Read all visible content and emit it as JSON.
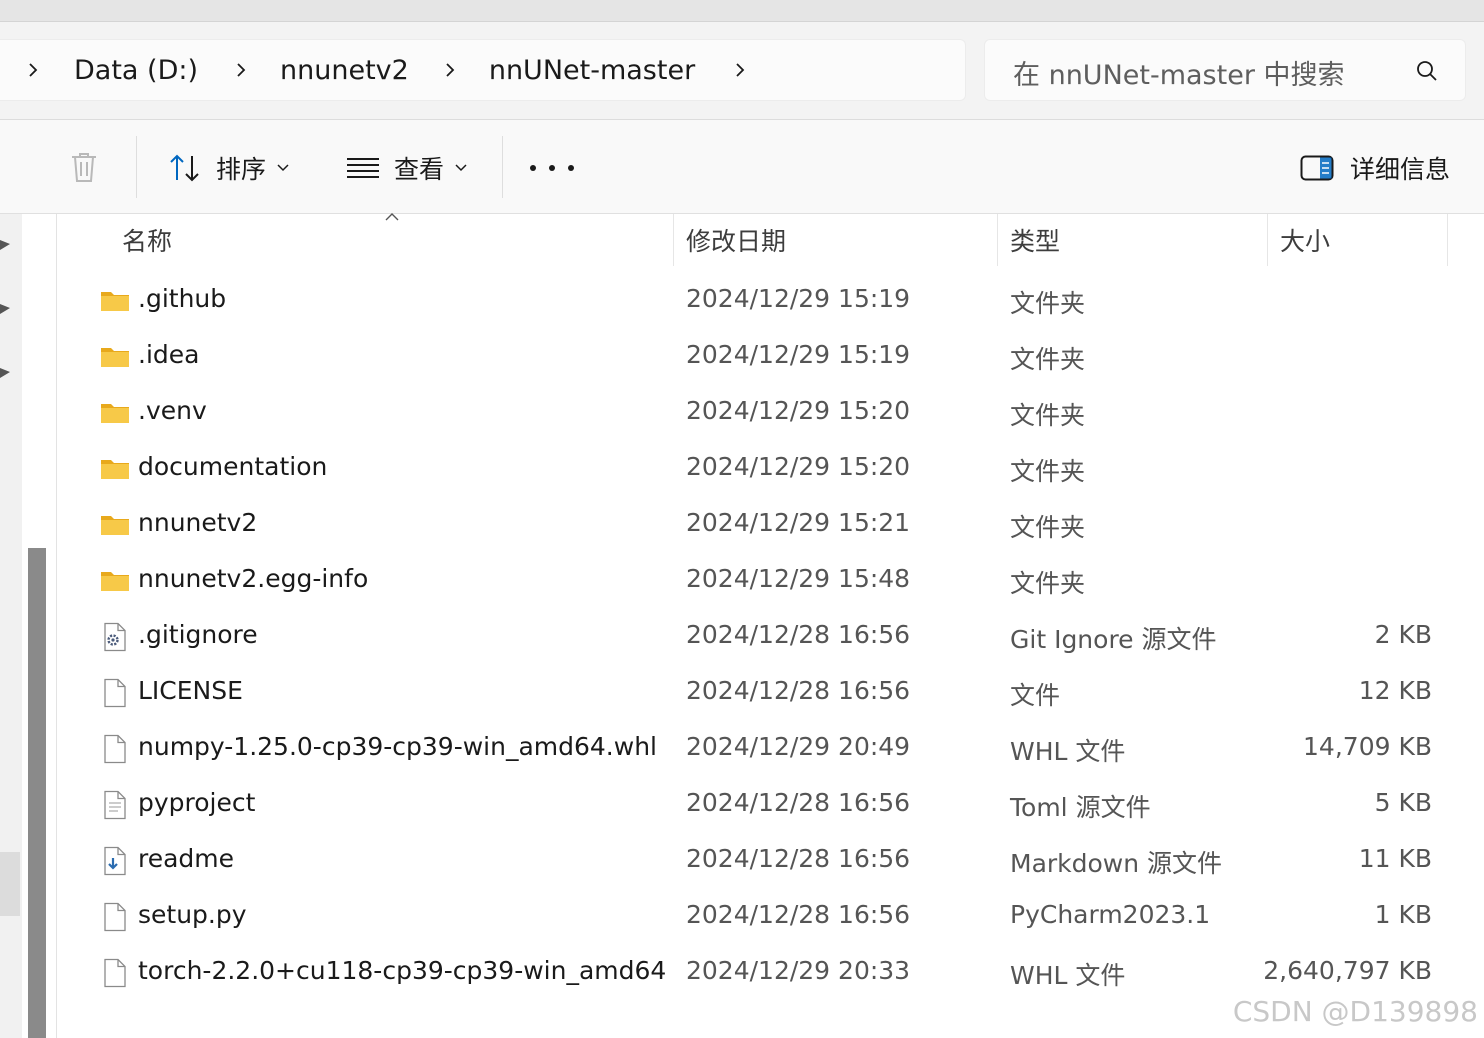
{
  "breadcrumb": {
    "items": [
      "Data (D:)",
      "nnunetv2",
      "nnUNet-master"
    ]
  },
  "search": {
    "placeholder": "在 nnUNet-master 中搜索"
  },
  "command_bar": {
    "sort_label": "排序",
    "view_label": "查看",
    "details_label": "详细信息"
  },
  "columns": {
    "name": "名称",
    "date": "修改日期",
    "type": "类型",
    "size": "大小"
  },
  "files": [
    {
      "name": ".github",
      "date": "2024/12/29 15:19",
      "type": "文件夹",
      "size": "",
      "icon": "folder-icon"
    },
    {
      "name": ".idea",
      "date": "2024/12/29 15:19",
      "type": "文件夹",
      "size": "",
      "icon": "folder-icon"
    },
    {
      "name": ".venv",
      "date": "2024/12/29 15:20",
      "type": "文件夹",
      "size": "",
      "icon": "folder-icon"
    },
    {
      "name": "documentation",
      "date": "2024/12/29 15:20",
      "type": "文件夹",
      "size": "",
      "icon": "folder-icon"
    },
    {
      "name": "nnunetv2",
      "date": "2024/12/29 15:21",
      "type": "文件夹",
      "size": "",
      "icon": "folder-icon"
    },
    {
      "name": "nnunetv2.egg-info",
      "date": "2024/12/29 15:48",
      "type": "文件夹",
      "size": "",
      "icon": "folder-icon"
    },
    {
      "name": ".gitignore",
      "date": "2024/12/28 16:56",
      "type": "Git Ignore 源文件",
      "size": "2 KB",
      "icon": "settings-file-icon"
    },
    {
      "name": "LICENSE",
      "date": "2024/12/28 16:56",
      "type": "文件",
      "size": "12 KB",
      "icon": "blank-file-icon"
    },
    {
      "name": "numpy-1.25.0-cp39-cp39-win_amd64.whl",
      "date": "2024/12/29 20:49",
      "type": "WHL 文件",
      "size": "14,709 KB",
      "icon": "blank-file-icon"
    },
    {
      "name": "pyproject",
      "date": "2024/12/28 16:56",
      "type": "Toml 源文件",
      "size": "5 KB",
      "icon": "text-file-icon"
    },
    {
      "name": "readme",
      "date": "2024/12/28 16:56",
      "type": "Markdown 源文件",
      "size": "11 KB",
      "icon": "markdown-file-icon"
    },
    {
      "name": "setup.py",
      "date": "2024/12/28 16:56",
      "type": "PyCharm2023.1",
      "size": "1 KB",
      "icon": "blank-file-icon"
    },
    {
      "name": "torch-2.2.0+cu118-cp39-cp39-win_amd64....",
      "date": "2024/12/29 20:33",
      "type": "WHL 文件",
      "size": "2,640,797 KB",
      "icon": "blank-file-icon"
    }
  ],
  "watermark": "CSDN @D139898",
  "colors": {
    "folder": "#f7c948",
    "folder_dark": "#e8a91c",
    "accent": "#0067c0"
  }
}
